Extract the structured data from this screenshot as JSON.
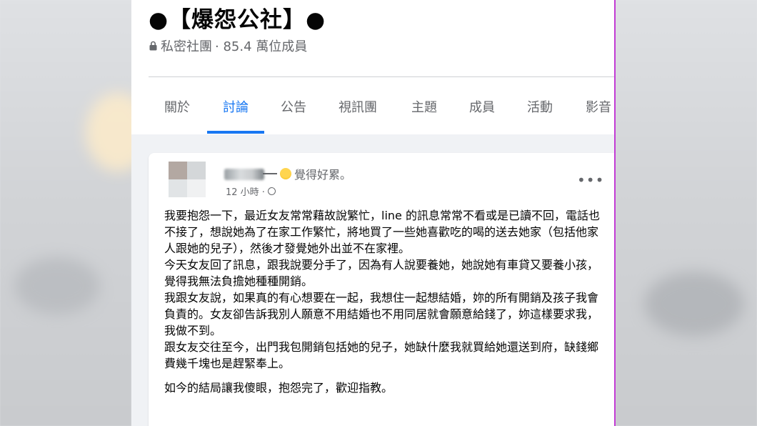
{
  "group": {
    "title": "●【爆怨公社】●",
    "privacy": "私密社團",
    "member_count": "· 85.4 萬位成員"
  },
  "tabs": [
    {
      "label": "關於"
    },
    {
      "label": "討論",
      "active": true
    },
    {
      "label": "公告"
    },
    {
      "label": "視訊團"
    },
    {
      "label": "主題"
    },
    {
      "label": "成員"
    },
    {
      "label": "活動"
    },
    {
      "label": "影音"
    }
  ],
  "post": {
    "author_prefix": "羽",
    "feeling": "覺得好累。",
    "time": "12 小時 ·",
    "more": "•••",
    "paragraphs": [
      "我要抱怨一下，最近女友常常藉故說繁忙，line 的訊息常常不看或是已讀不回，電話也不接了，想說她為了在家工作繁忙，將地買了一些她喜歡吃的喝的送去她家（包括他家人跟她的兒子），然後才發覺她外出並不在家裡。",
      "今天女友回了訊息，跟我說要分手了，因為有人說要養她，她說她有車貸又要養小孩，覺得我無法負擔她種種開銷。",
      "我跟女友說，如果真的有心想要在一起，我想住一起想結婚，妳的所有開銷及孩子我會負責的。女友卻告訴我別人願意不用結婚也不用同居就會願意給錢了，妳這樣要求我，我做不到。",
      "跟女友交往至今，出門我包開銷包括她的兒子，她缺什麼我就買給她還送到府，缺錢鄉費幾千塊也是趕緊奉上。",
      "如今的結局讓我傻眼，抱怨完了，歡迎指教。"
    ]
  },
  "colors": {
    "accent": "#1877f2",
    "text_primary": "#050505",
    "text_secondary": "#65676b",
    "page_bg": "#f0f2f5"
  }
}
